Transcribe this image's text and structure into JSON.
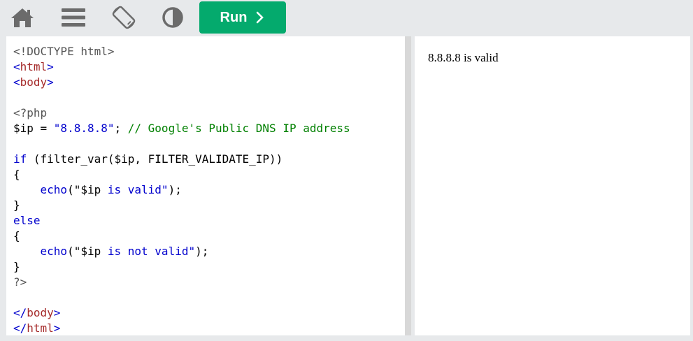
{
  "toolbar": {
    "icons": [
      {
        "name": "home-icon",
        "color": "#6b6b6b"
      },
      {
        "name": "menu-icon",
        "color": "#6b6b6b"
      },
      {
        "name": "rotate-screen-icon",
        "color": "#6b6b6b"
      },
      {
        "name": "contrast-icon",
        "color": "#6b6b6b"
      }
    ],
    "run_label": "Run",
    "run_color": "#04aa6d"
  },
  "code": {
    "lines": [
      "<!DOCTYPE html>",
      "<html>",
      "<body>",
      "",
      "<?php",
      "$ip = \"8.8.8.8\"; // Google's Public DNS IP address",
      "",
      "if (filter_var($ip, FILTER_VALIDATE_IP))",
      "{",
      "    echo(\"$ip is valid\");",
      "}",
      "else",
      "{",
      "    echo(\"$ip is not valid\");",
      "}",
      "?>",
      "",
      "</body>",
      "</html>"
    ]
  },
  "result": {
    "text": "8.8.8.8 is valid"
  }
}
